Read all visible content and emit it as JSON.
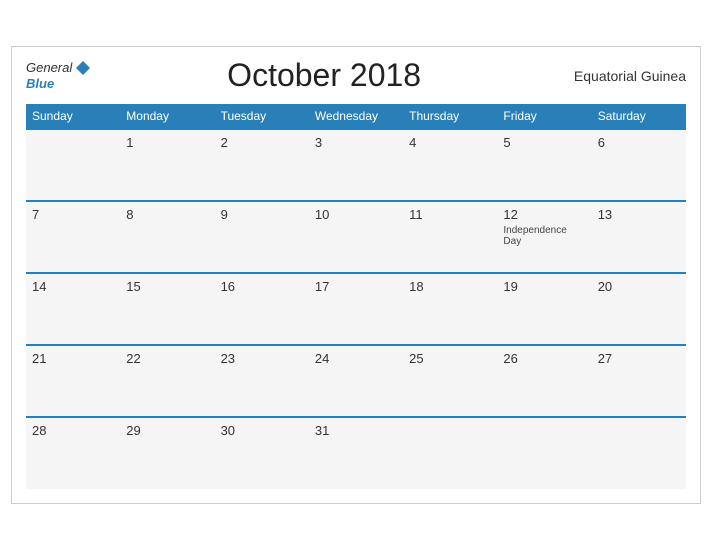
{
  "header": {
    "logo_general": "General",
    "logo_blue": "Blue",
    "month_title": "October 2018",
    "country": "Equatorial Guinea"
  },
  "weekdays": [
    "Sunday",
    "Monday",
    "Tuesday",
    "Wednesday",
    "Thursday",
    "Friday",
    "Saturday"
  ],
  "weeks": [
    [
      {
        "day": "",
        "event": ""
      },
      {
        "day": "1",
        "event": ""
      },
      {
        "day": "2",
        "event": ""
      },
      {
        "day": "3",
        "event": ""
      },
      {
        "day": "4",
        "event": ""
      },
      {
        "day": "5",
        "event": ""
      },
      {
        "day": "6",
        "event": ""
      }
    ],
    [
      {
        "day": "7",
        "event": ""
      },
      {
        "day": "8",
        "event": ""
      },
      {
        "day": "9",
        "event": ""
      },
      {
        "day": "10",
        "event": ""
      },
      {
        "day": "11",
        "event": ""
      },
      {
        "day": "12",
        "event": "Independence Day"
      },
      {
        "day": "13",
        "event": ""
      }
    ],
    [
      {
        "day": "14",
        "event": ""
      },
      {
        "day": "15",
        "event": ""
      },
      {
        "day": "16",
        "event": ""
      },
      {
        "day": "17",
        "event": ""
      },
      {
        "day": "18",
        "event": ""
      },
      {
        "day": "19",
        "event": ""
      },
      {
        "day": "20",
        "event": ""
      }
    ],
    [
      {
        "day": "21",
        "event": ""
      },
      {
        "day": "22",
        "event": ""
      },
      {
        "day": "23",
        "event": ""
      },
      {
        "day": "24",
        "event": ""
      },
      {
        "day": "25",
        "event": ""
      },
      {
        "day": "26",
        "event": ""
      },
      {
        "day": "27",
        "event": ""
      }
    ],
    [
      {
        "day": "28",
        "event": ""
      },
      {
        "day": "29",
        "event": ""
      },
      {
        "day": "30",
        "event": ""
      },
      {
        "day": "31",
        "event": ""
      },
      {
        "day": "",
        "event": ""
      },
      {
        "day": "",
        "event": ""
      },
      {
        "day": "",
        "event": ""
      }
    ]
  ]
}
